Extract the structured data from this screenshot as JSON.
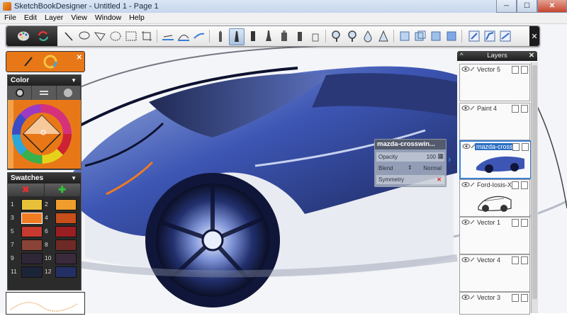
{
  "window": {
    "title": "SketchBookDesigner - Untitled 1 - Page 1",
    "minimize": "─",
    "maximize": "☐",
    "close": "✕"
  },
  "menu": [
    "File",
    "Edit",
    "Layer",
    "View",
    "Window",
    "Help"
  ],
  "toolbar": {
    "close": "✕"
  },
  "brush_panel": {
    "close": "✕"
  },
  "color_panel": {
    "title": "Color"
  },
  "swatches": {
    "title": "Swatches",
    "remove": "✖",
    "add": "✚",
    "items": [
      {
        "n": "1",
        "color": "#e8c13b"
      },
      {
        "n": "2",
        "color": "#ef9d2c"
      },
      {
        "n": "3",
        "color": "#ef7c22"
      },
      {
        "n": "4",
        "color": "#c84f1c"
      },
      {
        "n": "5",
        "color": "#c63a2f"
      },
      {
        "n": "6",
        "color": "#9a1e22"
      },
      {
        "n": "7",
        "color": "#8a4337"
      },
      {
        "n": "8",
        "color": "#6e2a26"
      },
      {
        "n": "9",
        "color": "#2f2738"
      },
      {
        "n": "10",
        "color": "#3a2a3c"
      },
      {
        "n": "11",
        "color": "#1c2438"
      },
      {
        "n": "12",
        "color": "#243064"
      }
    ],
    "selected_color": "#ef7c22"
  },
  "layers": {
    "title": "Layers",
    "items": [
      {
        "name": "Vector 5",
        "selected": false
      },
      {
        "name": "Paint 4",
        "selected": false
      },
      {
        "name": "mazda-crosswin...",
        "selected": true
      },
      {
        "name": "Ford-Iosis-X-...",
        "selected": false
      },
      {
        "name": "Vector 1",
        "selected": false
      },
      {
        "name": "Vector 4",
        "selected": false
      },
      {
        "name": "Vector 3",
        "selected": false
      }
    ]
  },
  "layer_properties": {
    "title": "mazda-crosswin...",
    "opacity_label": "Opacity",
    "opacity_value": "100",
    "blend_label": "Blend",
    "blend_value": "Normal",
    "symmetry_label": "Symmetry"
  },
  "colors": {
    "accent_orange": "#e87817",
    "selection_blue": "#2d6fc4"
  }
}
